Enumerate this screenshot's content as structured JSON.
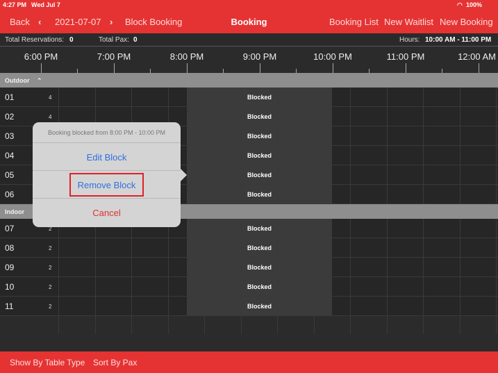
{
  "status_bar": {
    "time": "4:27 PM",
    "date": "Wed Jul 7",
    "battery": "100%"
  },
  "header": {
    "back": "Back",
    "prev_icon": "chevron-left",
    "date": "2021-07-07",
    "next_icon": "chevron-right",
    "block_booking": "Block Booking",
    "title": "Booking",
    "booking_list": "Booking List",
    "new_waitlist": "New Waitlist",
    "new_booking": "New Booking"
  },
  "info": {
    "total_reservations_label": "Total Reservations:",
    "total_reservations": "0",
    "total_pax_label": "Total Pax:",
    "total_pax": "0",
    "hours_label": "Hours:",
    "hours": "10:00 AM - 11:00 PM"
  },
  "timeline": [
    "6:00 PM",
    "7:00 PM",
    "8:00 PM",
    "9:00 PM",
    "10:00 PM",
    "11:00 PM",
    "12:00 AM"
  ],
  "groups": [
    {
      "name": "Outdoor",
      "rows": [
        {
          "table": "01",
          "pax": "4",
          "status": "Blocked"
        },
        {
          "table": "02",
          "pax": "4",
          "status": "Blocked"
        },
        {
          "table": "03",
          "pax": "4",
          "status": "Blocked"
        },
        {
          "table": "04",
          "pax": "4",
          "status": "Blocked"
        },
        {
          "table": "05",
          "pax": "4",
          "status": "Blocked"
        },
        {
          "table": "06",
          "pax": "4",
          "status": "Blocked"
        }
      ]
    },
    {
      "name": "Indoor",
      "rows": [
        {
          "table": "07",
          "pax": "2",
          "status": "Blocked"
        },
        {
          "table": "08",
          "pax": "2",
          "status": "Blocked"
        },
        {
          "table": "09",
          "pax": "2",
          "status": "Blocked"
        },
        {
          "table": "10",
          "pax": "2",
          "status": "Blocked"
        },
        {
          "table": "11",
          "pax": "2",
          "status": "Blocked"
        }
      ]
    }
  ],
  "popover": {
    "message": "Booking blocked from 8:00 PM - 10:00 PM",
    "edit": "Edit Block",
    "remove": "Remove Block",
    "cancel": "Cancel"
  },
  "footer": {
    "show_by_table_type": "Show By Table Type",
    "sort_by_pax": "Sort By Pax"
  },
  "colors": {
    "accent": "#e53333",
    "link": "#2f6fe0",
    "destructive": "#e03030"
  }
}
